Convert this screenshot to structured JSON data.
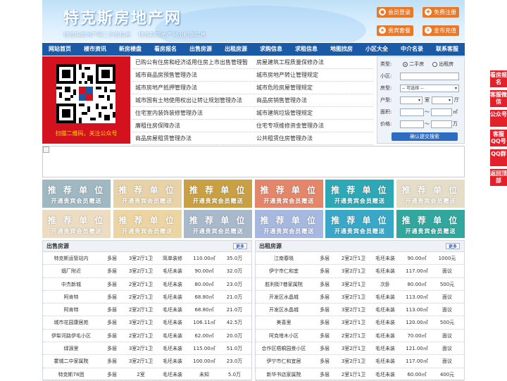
{
  "header": {
    "site_title": "特克斯房地产网",
    "subtitle_1": "特克斯房地产网二手房信息",
    "subtitle_2": "特克斯房地产网出租房信息",
    "buttons": {
      "login": "会员登录",
      "register": "免费注册",
      "vip": "贵宾套餐",
      "recharge": "金币充值"
    }
  },
  "nav": [
    "网站首页",
    "楼市资讯",
    "新房楼盘",
    "看房报名",
    "出售房源",
    "出租房源",
    "求购信息",
    "求租信息",
    "地图找房",
    "小区大全",
    "中介名录",
    "联系客服"
  ],
  "qr_caption": "扫描二维码，关注公众号",
  "links": {
    "left": [
      "已购公有住房和经济适用住房上市出售管理暂",
      "城市商品房预售管理办法",
      "城市房地产抵押管理办法",
      "城市国有土地使用权出让转让规划管理办法",
      "住宅室内装饰装修管理办法",
      "廉租住房保障办法",
      "商品房屋租赁管理办法"
    ],
    "right": [
      "房屋建筑工程质量保修办法",
      "城市房地产转让管理规定",
      "城市危险房屋管理规定",
      "商品房销售管理办法",
      "城市建筑垃圾管理规定",
      "住宅专项维修资金管理办法",
      "公共租赁住房管理办法"
    ]
  },
  "search": {
    "type_label": "类型:",
    "type_options": [
      "二手房",
      "出租房"
    ],
    "district_label": "小区:",
    "room_label": "房型:",
    "room_select": "-- 可选择 --",
    "layout_label": "户型:",
    "layout_unit_1": "室",
    "layout_unit_2": "厅",
    "area_label": "面积:",
    "area_sep": "〜",
    "area_unit": "㎡",
    "price_label": "价格:",
    "price_sep": "〜",
    "price_unit": "万",
    "submit": "确认提交搜索"
  },
  "ad_cells": {
    "line1": "推 荐 单 位",
    "line2": "开通贵宾会员赠送",
    "colors": [
      "#9fb8c2",
      "#e8d2a8",
      "#c9a043",
      "#e5866a",
      "#2fa8b5",
      "#e5ddc7",
      "#ecdcc2",
      "#ecd5a3",
      "#a9b9cc",
      "#a7b8e0",
      "#39a8c8",
      "#32a79d"
    ]
  },
  "sale": {
    "title": "出售房源",
    "more": "更多",
    "rows": [
      [
        "特克斯运管站内",
        "多层",
        "3室2厅1卫",
        "简单装修",
        "110.00㎡",
        "35.0万"
      ],
      [
        "烟厂附近",
        "多层",
        "3室2厅1卫",
        "毛坯未装",
        "90.00㎡",
        "32.0万"
      ],
      [
        "中杰新城",
        "多层",
        "2室2厅1卫",
        "毛坯未装",
        "80.00㎡",
        "23.0万"
      ],
      [
        "阿肯特",
        "多层",
        "2室2厅1卫",
        "毛坯未装",
        "68.80㎡",
        "21.0万"
      ],
      [
        "阿肯特",
        "多层",
        "2室2厅1卫",
        "毛坯未装",
        "68.80㎡",
        "21.0万"
      ],
      [
        "城市花园康居苑",
        "多层",
        "3室2厅1卫",
        "毛坯未装",
        "106.11㎡",
        "42.5万"
      ],
      [
        "伊犁河路伊毛小区",
        "多层",
        "2室2厅1卫",
        "毛坯未装",
        "62.00㎡",
        "20.0万"
      ],
      [
        "绿源里",
        "多层",
        "3室2厅1卫",
        "毛坯未装",
        "115.00㎡",
        "51.0万"
      ],
      [
        "霍城二中家属院",
        "多层",
        "3室2厅1卫",
        "毛坯未装",
        "100.00㎡",
        "23.0万"
      ],
      [
        "特克斯78团",
        "多层",
        "2室",
        "毛坯未装",
        "未知",
        "5.0万"
      ]
    ]
  },
  "rent": {
    "title": "出租房源",
    "more": "更多",
    "rows": [
      [
        "江南春晓",
        "多层",
        "2室2厅1卫",
        "毛坯未装",
        "90.00㎡",
        "1000元"
      ],
      [
        "伊宁市仁和宜",
        "多层",
        "3室2厅1卫",
        "毛坯未装",
        "117.00㎡",
        "面议"
      ],
      [
        "胜利街7巷家属院",
        "多层",
        "3室2厅1卫",
        "次卧",
        "80.00㎡",
        "500元"
      ],
      [
        "开发区水晶城",
        "多层",
        "3室2厅1卫",
        "毛坯未装",
        "113.00㎡",
        "面议"
      ],
      [
        "开发区水晶城",
        "多层",
        "3室2厅1卫",
        "毛坯未装",
        "113.00㎡",
        "面议"
      ],
      [
        "美喜里",
        "多层",
        "3室2厅1卫",
        "毛坯未装",
        "120.00㎡",
        "500元"
      ],
      [
        "阿克塔木小区",
        "多层",
        "2室2厅1卫",
        "毛坯未装",
        "70.00㎡",
        "面议"
      ],
      [
        "合作区梧桐园景小区",
        "多层",
        "3室2厅1卫",
        "毛坯未装",
        "121.00㎡",
        "面议"
      ],
      [
        "伊宁市仁和宜居",
        "多层",
        "3室2厅1卫",
        "毛坯未装",
        "117.00㎡",
        "面议"
      ],
      [
        "新华书店家属院",
        "多层",
        "2室1厅1卫",
        "毛坯未装",
        "60.00㎡",
        "400元"
      ]
    ]
  },
  "sidebar": [
    "看房报名",
    "客服微信",
    "公众号",
    "客服QQ号",
    "QQ群",
    "返回顶部"
  ]
}
